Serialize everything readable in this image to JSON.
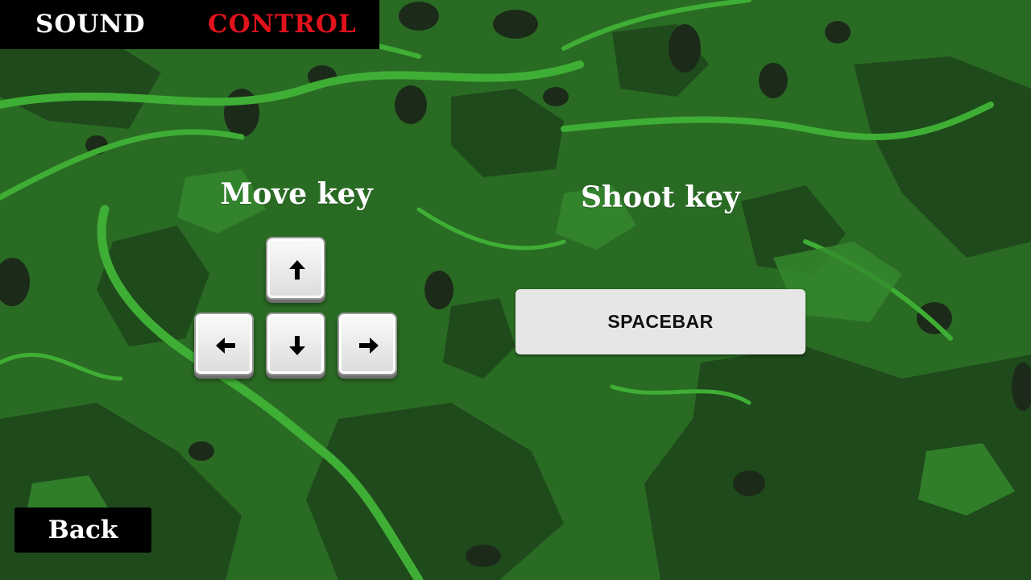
{
  "tabs": {
    "sound_label": "SOUND",
    "control_label": "CONTROL",
    "active": "CONTROL",
    "active_color": "#e0121c",
    "inactive_color": "#ffffff"
  },
  "move": {
    "heading": "Move key",
    "keys": [
      {
        "name": "up",
        "icon": "arrow-up-icon"
      },
      {
        "name": "left",
        "icon": "arrow-left-icon"
      },
      {
        "name": "down",
        "icon": "arrow-down-icon"
      },
      {
        "name": "right",
        "icon": "arrow-right-icon"
      }
    ]
  },
  "shoot": {
    "heading": "Shoot key",
    "key_label": "SPACEBAR"
  },
  "back_label": "Back",
  "colors": {
    "background_dark": "#1f4d1c",
    "background_mid": "#2a6b24",
    "background_light": "#3fae35",
    "panel": "#000000",
    "key_face": "#e6e6e6"
  }
}
